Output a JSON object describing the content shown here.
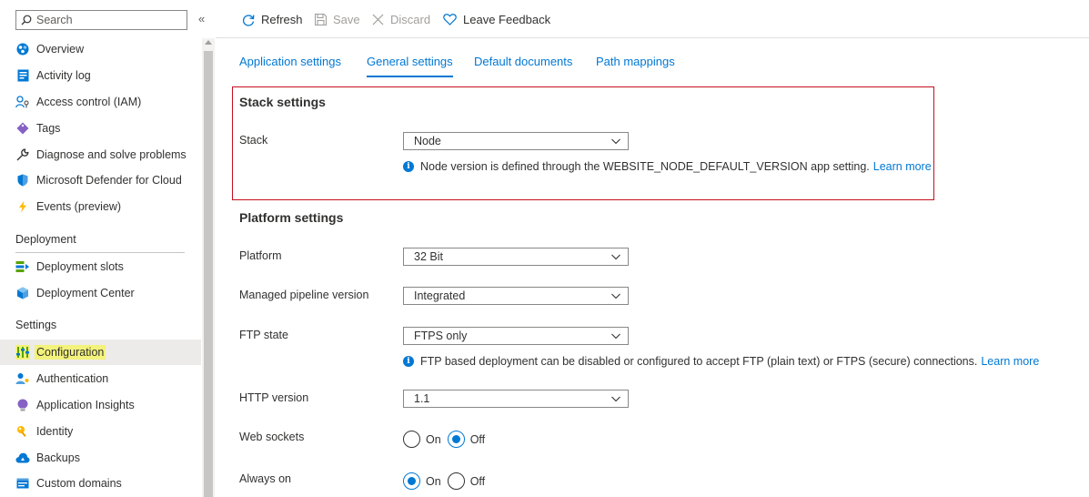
{
  "sidebar": {
    "search_placeholder": "Search",
    "collapse_glyph": "«",
    "items_top": [
      {
        "label": "Overview",
        "icon": "overview-icon"
      },
      {
        "label": "Activity log",
        "icon": "activity-log-icon"
      },
      {
        "label": "Access control (IAM)",
        "icon": "access-control-icon"
      },
      {
        "label": "Tags",
        "icon": "tag-icon"
      },
      {
        "label": "Diagnose and solve problems",
        "icon": "wrench-icon"
      },
      {
        "label": "Microsoft Defender for Cloud",
        "icon": "shield-icon"
      },
      {
        "label": "Events (preview)",
        "icon": "lightning-icon"
      }
    ],
    "deployment_header": "Deployment",
    "items_deployment": [
      {
        "label": "Deployment slots",
        "icon": "deployment-slots-icon"
      },
      {
        "label": "Deployment Center",
        "icon": "cube-icon"
      }
    ],
    "settings_header": "Settings",
    "items_settings": [
      {
        "label": "Configuration",
        "icon": "configuration-icon",
        "active": true
      },
      {
        "label": "Authentication",
        "icon": "user-key-icon"
      },
      {
        "label": "Application Insights",
        "icon": "bulb-icon"
      },
      {
        "label": "Identity",
        "icon": "identity-icon"
      },
      {
        "label": "Backups",
        "icon": "cloud-icon"
      },
      {
        "label": "Custom domains",
        "icon": "domain-icon"
      }
    ]
  },
  "toolbar": {
    "refresh": "Refresh",
    "save": "Save",
    "discard": "Discard",
    "feedback": "Leave Feedback"
  },
  "tabs": [
    {
      "label": "Application settings"
    },
    {
      "label": "General settings",
      "active": true
    },
    {
      "label": "Default documents"
    },
    {
      "label": "Path mappings"
    }
  ],
  "stack_settings": {
    "title": "Stack settings",
    "stack_label": "Stack",
    "stack_value": "Node",
    "info_text": "Node version is defined through the WEBSITE_NODE_DEFAULT_VERSION app setting.",
    "learn_more": "Learn more"
  },
  "platform_settings": {
    "title": "Platform settings",
    "platform_label": "Platform",
    "platform_value": "32 Bit",
    "pipeline_label": "Managed pipeline version",
    "pipeline_value": "Integrated",
    "ftp_label": "FTP state",
    "ftp_value": "FTPS only",
    "ftp_info": "FTP based deployment can be disabled or configured to accept FTP (plain text) or FTPS (secure) connections.",
    "ftp_learn_more": "Learn more",
    "http_label": "HTTP version",
    "http_value": "1.1",
    "websockets_label": "Web sockets",
    "websockets_on": "On",
    "websockets_off": "Off",
    "websockets_selected": "Off",
    "alwayson_label": "Always on",
    "alwayson_on": "On",
    "alwayson_off": "Off",
    "alwayson_selected": "On"
  },
  "colors": {
    "accent": "#0078d4",
    "highlight_border": "#c50f1f",
    "active_highlight": "#f3f27a"
  }
}
